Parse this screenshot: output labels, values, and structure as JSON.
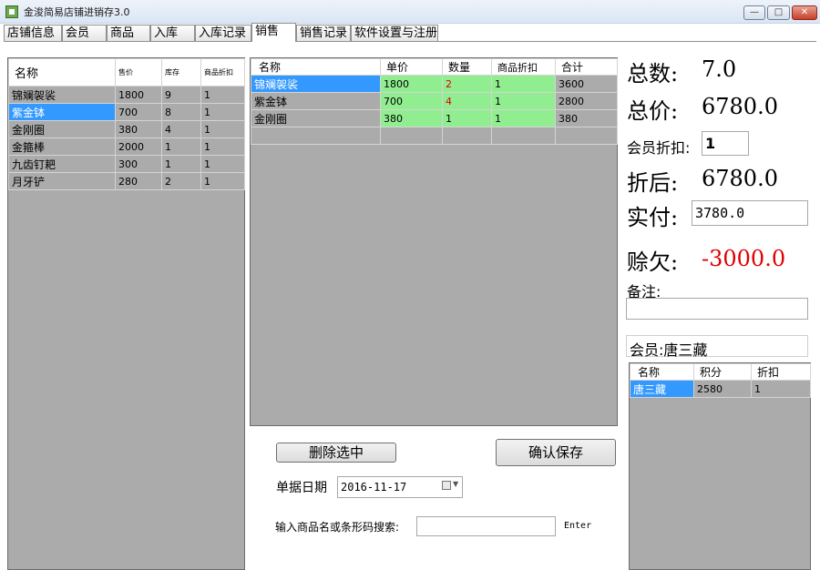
{
  "window": {
    "title": "金浚简易店铺进销存3.0",
    "controls": {
      "minimize": "—",
      "maximize": "□",
      "close": "✕"
    }
  },
  "tabs": [
    "店铺信息",
    "会员",
    "商品",
    "入库",
    "入库记录",
    "销售",
    "销售记录",
    "软件设置与注册"
  ],
  "active_tab": "销售",
  "product_list": {
    "headers": [
      "名称",
      "售价",
      "库存",
      "商品折扣"
    ],
    "rows": [
      [
        "锦斓袈裟",
        "1800",
        "9",
        "1"
      ],
      [
        "紫金钵",
        "700",
        "8",
        "1"
      ],
      [
        "金刚圈",
        "380",
        "4",
        "1"
      ],
      [
        "金箍棒",
        "2000",
        "1",
        "1"
      ],
      [
        "九齿钉耙",
        "300",
        "1",
        "1"
      ],
      [
        "月牙铲",
        "280",
        "2",
        "1"
      ]
    ],
    "selected_row": 1
  },
  "cart": {
    "headers": [
      "名称",
      "单价",
      "数量",
      "商品折扣",
      "合计"
    ],
    "rows": [
      [
        "锦斓袈裟",
        "1800",
        "2",
        "1",
        "3600"
      ],
      [
        "紫金钵",
        "700",
        "4",
        "1",
        "2800"
      ],
      [
        "金刚圈",
        "380",
        "1",
        "1",
        "380"
      ]
    ]
  },
  "summary": {
    "total_count_label": "总数:",
    "total_count": "7.0",
    "total_price_label": "总价:",
    "total_price": "6780.0",
    "member_discount_label": "会员折扣:",
    "member_discount": "1",
    "after_discount_label": "折后:",
    "after_discount": "6780.0",
    "paid_label": "实付:",
    "paid": "3780.0",
    "debt_label": "赊欠:",
    "debt": "-3000.0",
    "note_label": "备注:",
    "note": "",
    "member_label": "会员:唐三藏"
  },
  "member_table": {
    "headers": [
      "名称",
      "积分",
      "折扣"
    ],
    "rows": [
      [
        "唐三藏",
        "2580",
        "1"
      ]
    ]
  },
  "actions": {
    "delete_label": "删除选中",
    "confirm_label": "确认保存",
    "date_label": "单据日期",
    "date_value": "2016-11-17",
    "search_label": "输入商品名或条形码搜索:",
    "search_value": "",
    "enter_label": "Enter"
  }
}
